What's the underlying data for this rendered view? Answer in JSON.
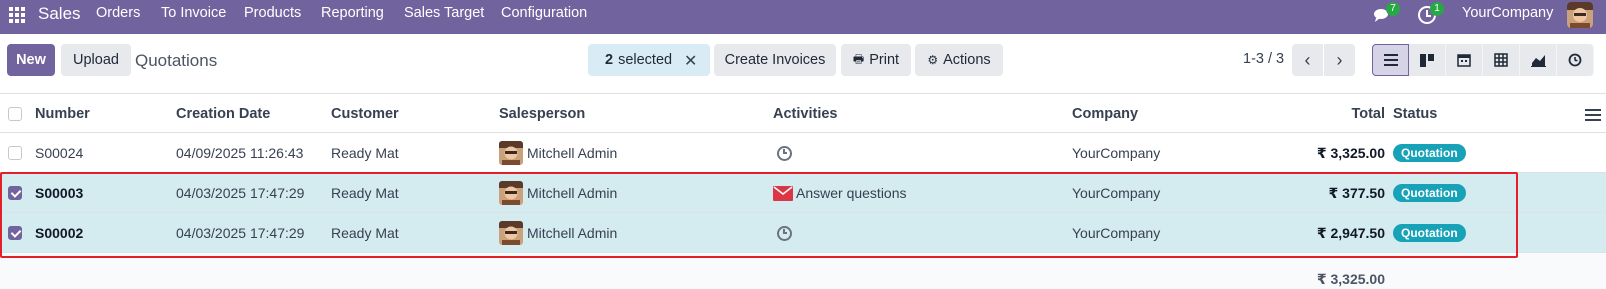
{
  "navbar": {
    "app_name": "Sales",
    "menu": [
      "Orders",
      "To Invoice",
      "Products",
      "Reporting",
      "Sales Target",
      "Configuration"
    ],
    "messages_count": "7",
    "activities_count": "1",
    "company": "YourCompany",
    "icons": [
      "apps-grid-icon",
      "chat-icon",
      "clock-icon",
      "user-avatar"
    ]
  },
  "control_panel": {
    "new_label": "New",
    "upload_label": "Upload",
    "title": "Quotations",
    "selected_count": "2",
    "selected_label": "selected",
    "create_invoices_label": "Create Invoices",
    "print_label": "Print",
    "actions_label": "Actions",
    "pager": "1-3 / 3",
    "views": [
      "list-icon",
      "kanban-icon",
      "calendar-icon",
      "pivot-icon",
      "graph-icon",
      "activity-icon"
    ],
    "active_view": "list"
  },
  "table": {
    "headers": {
      "number": "Number",
      "creation_date": "Creation Date",
      "customer": "Customer",
      "salesperson": "Salesperson",
      "activities": "Activities",
      "company": "Company",
      "total": "Total",
      "status": "Status"
    },
    "rows": [
      {
        "number": "S00024",
        "creation_date": "04/09/2025 11:26:43",
        "customer": "Ready Mat",
        "salesperson": "Mitchell Admin",
        "activity": "",
        "activity_icon": "clock-icon",
        "company": "YourCompany",
        "total": "₹ 3,325.00",
        "status": "Quotation",
        "selected": false
      },
      {
        "number": "S00003",
        "creation_date": "04/03/2025 17:47:29",
        "customer": "Ready Mat",
        "salesperson": "Mitchell Admin",
        "activity": "Answer questions",
        "activity_icon": "envelope-icon",
        "company": "YourCompany",
        "total": "₹ 377.50",
        "status": "Quotation",
        "selected": true
      },
      {
        "number": "S00002",
        "creation_date": "04/03/2025 17:47:29",
        "customer": "Ready Mat",
        "salesperson": "Mitchell Admin",
        "activity": "",
        "activity_icon": "clock-icon",
        "company": "YourCompany",
        "total": "₹ 2,947.50",
        "status": "Quotation",
        "selected": true
      }
    ],
    "footer_total": "₹ 3,325.00"
  },
  "colors": {
    "brand": "#71639e",
    "selected_row": "#d4ebf0",
    "status_badge": "#17a2b8",
    "highlight_outline": "#e2202c"
  }
}
